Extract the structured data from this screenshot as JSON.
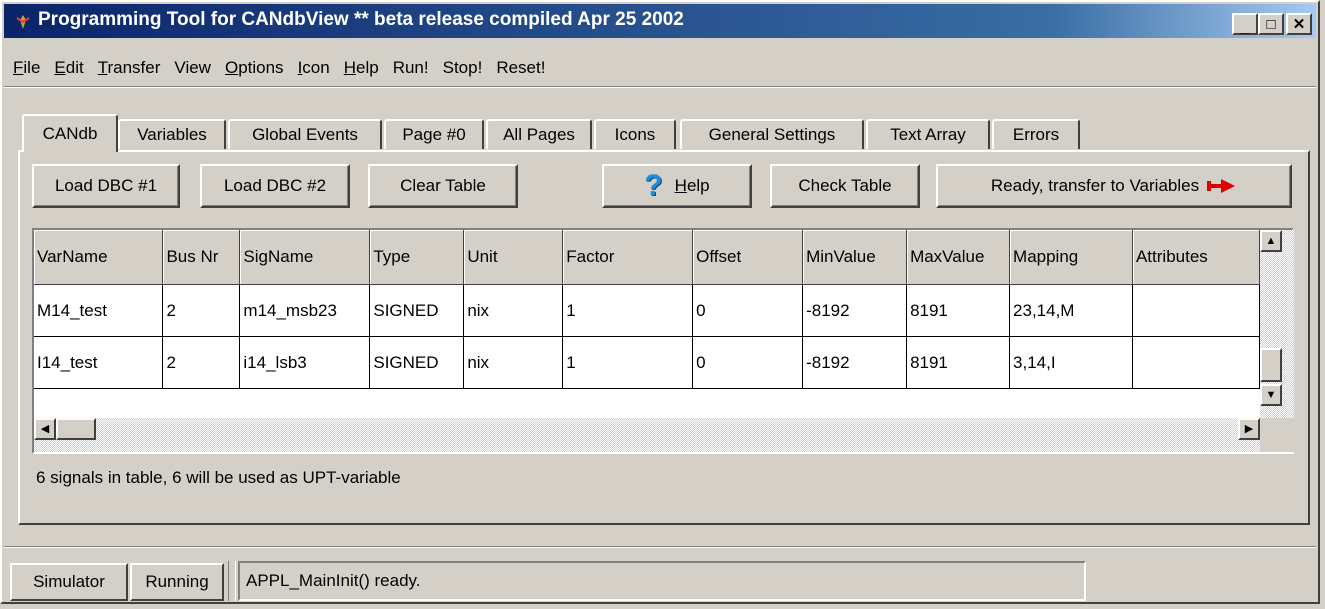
{
  "window": {
    "title": "Programming Tool for CANdbView    ** beta release compiled Apr 25 2002",
    "minimize_glyph": "_",
    "maximize_glyph": "□",
    "close_glyph": "✕"
  },
  "menu": [
    {
      "label": "File",
      "ul": "F",
      "rest": "ile"
    },
    {
      "label": "Edit",
      "ul": "E",
      "rest": "dit"
    },
    {
      "label": "Transfer",
      "ul": "T",
      "rest": "ransfer"
    },
    {
      "label": "View",
      "ul": "",
      "rest": "View"
    },
    {
      "label": "Options",
      "ul": "O",
      "rest": "ptions"
    },
    {
      "label": "Icon",
      "ul": "I",
      "rest": "con"
    },
    {
      "label": "Help",
      "ul": "H",
      "rest": "elp"
    },
    {
      "label": "Run!",
      "ul": "",
      "rest": "Run!"
    },
    {
      "label": "Stop!",
      "ul": "",
      "rest": "Stop!"
    },
    {
      "label": "Reset!",
      "ul": "",
      "rest": "Reset!"
    }
  ],
  "tabs": [
    "CANdb",
    "Variables",
    "Global Events",
    "Page #0",
    "All Pages",
    "Icons",
    "General Settings",
    "Text Array",
    "Errors"
  ],
  "active_tab": "CANdb",
  "toolbar": {
    "load1": "Load DBC #1",
    "load2": "Load DBC #2",
    "clear": "Clear Table",
    "help_icon": "?",
    "help_ul": "H",
    "help_rest": "elp",
    "check": "Check Table",
    "ready": "Ready, transfer to Variables"
  },
  "table": {
    "columns": [
      "VarName",
      "Bus Nr",
      "SigName",
      "Type",
      "Unit",
      "Factor",
      "Offset",
      "MinValue",
      "MaxValue",
      "Mapping",
      "Attributes"
    ],
    "rows": [
      [
        "M14_test",
        "2",
        "m14_msb23",
        "SIGNED",
        "nix",
        "1",
        "0",
        "-8192",
        "8191",
        "23,14,M",
        ""
      ],
      [
        "I14_test",
        "2",
        "i14_lsb3",
        "SIGNED",
        "nix",
        "1",
        "0",
        "-8192",
        "8191",
        "3,14,I",
        ""
      ]
    ]
  },
  "summary": "6 signals in table, 6 will be used as UPT-variable",
  "statusbar": {
    "simulator": "Simulator",
    "running": "Running",
    "message": "APPL_MainInit() ready."
  },
  "colors": {
    "titlebar": "#0a246a",
    "face": "#d4d0c8",
    "arrow": "#e00000",
    "help_icon": "#1a8fd6"
  }
}
